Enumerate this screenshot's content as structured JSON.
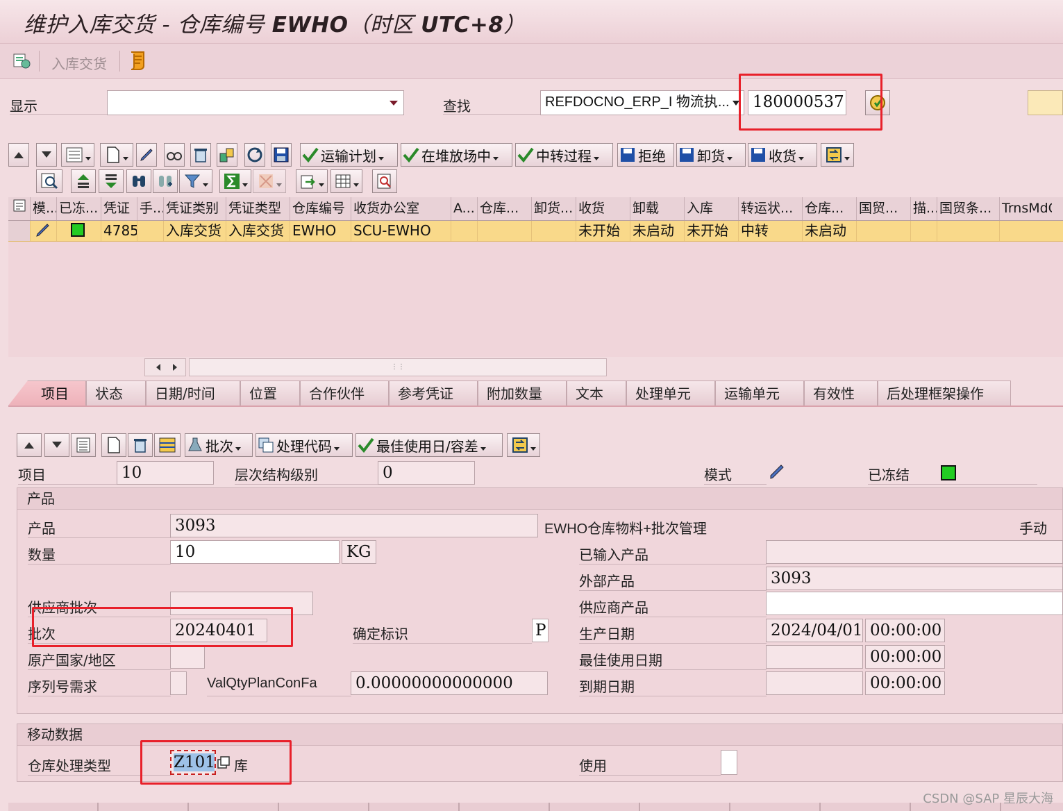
{
  "window": {
    "title_prefix": "维护入库交货 - 仓库编号 ",
    "title_bold1": "EWHO",
    "title_mid": "（时区 ",
    "title_bold2": "UTC+8",
    "title_suffix": "）"
  },
  "appbar": {
    "inbound_delivery_label": "入库交货"
  },
  "filter": {
    "display_label": "显示",
    "display_value": "",
    "find_label": "查找",
    "find_field": "REFDOCNO_ERP_I 物流执...",
    "find_value": "180000537"
  },
  "toolbar1": {
    "transport_plan": "运输计划",
    "in_yard": "在堆放场中",
    "transit": "中转过程",
    "reject": "拒绝",
    "unload": "卸货",
    "receive": "收货"
  },
  "grid": {
    "columns": [
      "模...",
      "已冻...",
      "凭证",
      "手...",
      "凭证类别",
      "凭证类型",
      "仓库编号",
      "收货办公室",
      "A...",
      "仓库...",
      "卸货...",
      "收货",
      "卸载",
      "入库",
      "转运状...",
      "仓库...",
      "国贸...",
      "描...",
      "国贸条...",
      "TrnsMdC"
    ],
    "row": {
      "doc": "4785",
      "category": "入库交货",
      "type": "入库交货",
      "warehouse": "EWHO",
      "office": "SCU-EWHO",
      "receipt": "未开始",
      "unload": "未启动",
      "putaway": "未开始",
      "transit": "中转",
      "wh_status": "未启动"
    }
  },
  "tabs": [
    "项目",
    "状态",
    "日期/时间",
    "位置",
    "合作伙伴",
    "参考凭证",
    "附加数量",
    "文本",
    "处理单元",
    "运输单元",
    "有效性",
    "后处理框架操作"
  ],
  "toolbar2": {
    "batch": "批次",
    "proc_code": "处理代码",
    "bbd": "最佳使用日/容差"
  },
  "item": {
    "item_label": "项目",
    "item_value": "10",
    "hier_label": "层次结构级别",
    "hier_value": "0",
    "mode_label": "模式",
    "frozen_label": "已冻结"
  },
  "product_group": {
    "header": "产品",
    "product_label": "产品",
    "product_value": "3093",
    "product_desc": "EWHO仓库物料+批次管理",
    "manual": "手动",
    "qty_label": "数量",
    "qty_value": "10",
    "uom": "KG",
    "entered_label": "已输入产品",
    "entered_value": "",
    "ext_label": "外部产品",
    "ext_value": "3093",
    "vendor_batch_label": "供应商批次",
    "vendor_batch_value": "",
    "vendor_prod_label": "供应商产品",
    "vendor_prod_value": "",
    "batch_label": "批次",
    "batch_value": "20240401",
    "fixed_label": "确定标识",
    "fixed_value": "P",
    "prod_date_label": "生产日期",
    "prod_date": "2024/04/01",
    "prod_time": "00:00:00",
    "origin_label": "原产国家/地区",
    "origin_value": "",
    "bbd_label": "最佳使用日期",
    "bbd_date": "",
    "bbd_time": "00:00:00",
    "serial_label": "序列号需求",
    "serial_value": "",
    "valqty_label": "ValQtyPlanConFa",
    "valqty_value": "0.00000000000000",
    "expiry_label": "到期日期",
    "expiry_date": "",
    "expiry_time": "00:00:00"
  },
  "movement_group": {
    "header": "移动数据",
    "proc_type_label": "仓库处理类型",
    "proc_type_value": "Z101",
    "proc_type_desc": "库",
    "use_label": "使用"
  },
  "watermark": "CSDN @SAP 星辰大海",
  "colors": {
    "row_highlight": "#f9d98a",
    "active_tab": "#f0b8c0",
    "annotation": "#e8202a",
    "frozen_green": "#22cc22"
  }
}
